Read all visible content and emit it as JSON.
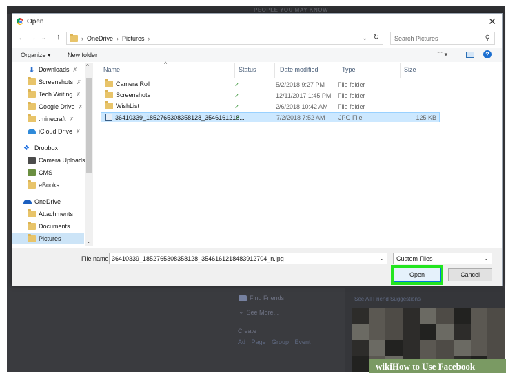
{
  "background_page": {
    "people_header": "PEOPLE YOU MAY KNOW",
    "find_friends": "Find Friends",
    "see_more": "See More...",
    "create_label": "Create",
    "create_links": "Ad  Page  Group  Event",
    "see_all": "See All Friend Suggestions",
    "watermark": "wikiHow to Use Facebook"
  },
  "dialog": {
    "title": "Open",
    "address": {
      "crumbs": [
        "OneDrive",
        "Pictures"
      ]
    },
    "search": {
      "placeholder": "Search Pictures"
    },
    "toolbar": {
      "organize": "Organize ▾",
      "new_folder": "New folder"
    },
    "nav": {
      "items": [
        {
          "label": "Downloads",
          "icon": "download-icon",
          "pinned": true
        },
        {
          "label": "Screenshots",
          "icon": "folder-icon",
          "pinned": true
        },
        {
          "label": "Tech Writing",
          "icon": "folder-icon",
          "pinned": true
        },
        {
          "label": "Google Drive",
          "icon": "folder-icon",
          "pinned": true
        },
        {
          "label": ".minecraft",
          "icon": "folder-icon",
          "pinned": true
        },
        {
          "label": "iCloud Drive",
          "icon": "cloud-icon",
          "pinned": true
        },
        {
          "label": "Dropbox",
          "icon": "dropbox-icon",
          "pinned": false
        },
        {
          "label": "Camera Uploads",
          "icon": "camera-folder-icon",
          "pinned": false
        },
        {
          "label": "CMS",
          "icon": "cms-folder-icon",
          "pinned": false
        },
        {
          "label": "eBooks",
          "icon": "folder-icon",
          "pinned": false
        },
        {
          "label": "OneDrive",
          "icon": "onedrive-icon",
          "pinned": false
        },
        {
          "label": "Attachments",
          "icon": "folder-icon",
          "pinned": false
        },
        {
          "label": "Documents",
          "icon": "folder-icon",
          "pinned": false
        },
        {
          "label": "Pictures",
          "icon": "folder-icon",
          "pinned": false,
          "selected": true
        }
      ]
    },
    "columns": [
      "Name",
      "Status",
      "Date modified",
      "Type",
      "Size"
    ],
    "files": [
      {
        "name": "Camera Roll",
        "status": "✓",
        "date": "5/2/2018 9:27 PM",
        "type": "File folder",
        "size": ""
      },
      {
        "name": "Screenshots",
        "status": "✓",
        "date": "12/11/2017 1:45 PM",
        "type": "File folder",
        "size": ""
      },
      {
        "name": "WishList",
        "status": "✓",
        "date": "2/6/2018 10:42 AM",
        "type": "File folder",
        "size": ""
      },
      {
        "name": "36410339_1852765308358128_3546161218...",
        "status": "✓",
        "date": "7/2/2018 7:52 AM",
        "type": "JPG File",
        "size": "125 KB",
        "selected": true
      }
    ],
    "file_name_label": "File name:",
    "file_name_value": "36410339_1852765308358128_3546161218483912704_n.jpg",
    "file_type": "Custom Files",
    "open_button": "Open",
    "cancel_button": "Cancel"
  }
}
